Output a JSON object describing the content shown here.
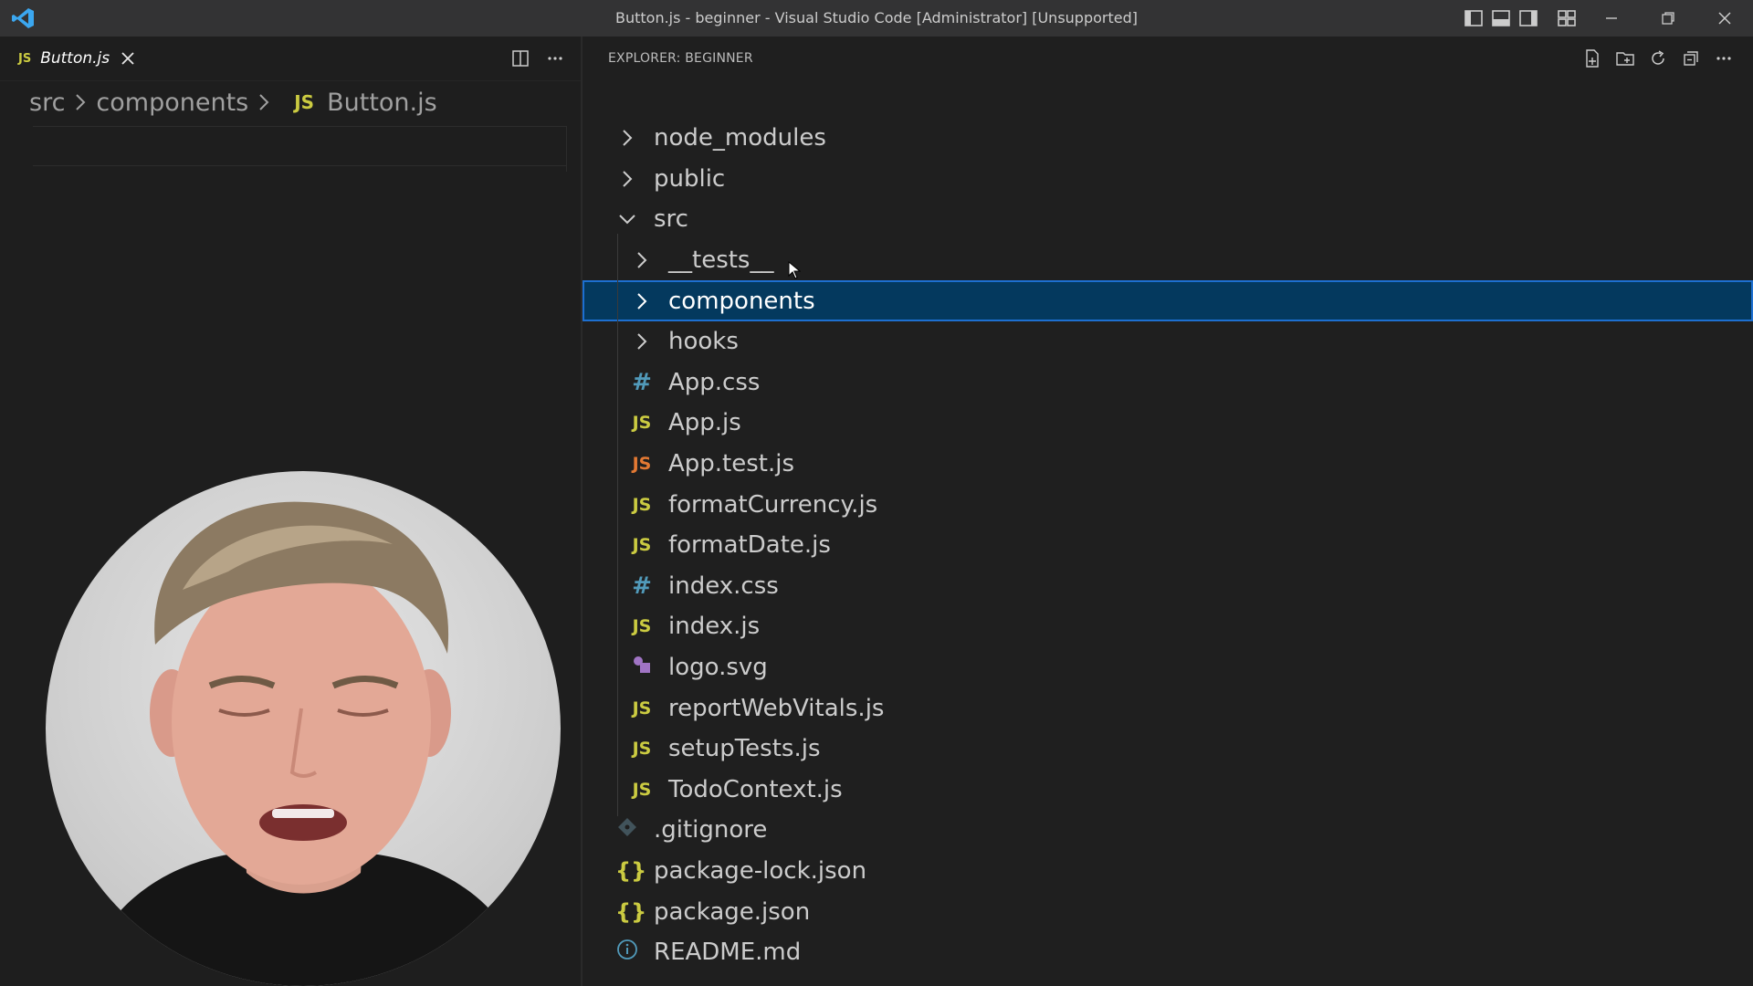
{
  "window": {
    "title": "Button.js - beginner - Visual Studio Code [Administrator] [Unsupported]"
  },
  "colors": {
    "titlebar_bg": "#333334",
    "editor_bg": "#1e1e1e",
    "selection_bg": "#04395e",
    "selection_border": "#1d6fd0",
    "js_icon": "#cbcb41",
    "test_icon": "#e37933",
    "css_icon": "#519aba"
  },
  "editor": {
    "tab": {
      "badge": "JS",
      "label": "Button.js",
      "icon": "close-icon"
    },
    "breadcrumb": {
      "parts": [
        "src",
        "components"
      ],
      "file_badge": "JS",
      "file": "Button.js"
    }
  },
  "explorer": {
    "header": "EXPLORER: BEGINNER",
    "actions": [
      "new-file-icon",
      "new-folder-icon",
      "refresh-icon",
      "collapse-all-icon",
      "more-icon"
    ],
    "items": [
      {
        "label": "node_modules",
        "type": "folder",
        "expanded": false,
        "depth": 0
      },
      {
        "label": "public",
        "type": "folder",
        "expanded": false,
        "depth": 0
      },
      {
        "label": "src",
        "type": "folder",
        "expanded": true,
        "depth": 0
      },
      {
        "label": "__tests__",
        "type": "folder",
        "expanded": false,
        "depth": 1
      },
      {
        "label": "components",
        "type": "folder",
        "expanded": false,
        "depth": 1,
        "selected": true
      },
      {
        "label": "hooks",
        "type": "folder",
        "expanded": false,
        "depth": 1
      },
      {
        "label": "App.css",
        "type": "css",
        "icon": "#",
        "depth": 1
      },
      {
        "label": "App.js",
        "type": "js",
        "icon": "JS",
        "depth": 1
      },
      {
        "label": "App.test.js",
        "type": "jstest",
        "icon": "JS",
        "depth": 1
      },
      {
        "label": "formatCurrency.js",
        "type": "js",
        "icon": "JS",
        "depth": 1
      },
      {
        "label": "formatDate.js",
        "type": "js",
        "icon": "JS",
        "depth": 1
      },
      {
        "label": "index.css",
        "type": "css",
        "icon": "#",
        "depth": 1
      },
      {
        "label": "index.js",
        "type": "js",
        "icon": "JS",
        "depth": 1
      },
      {
        "label": "logo.svg",
        "type": "svg",
        "depth": 1
      },
      {
        "label": "reportWebVitals.js",
        "type": "js",
        "icon": "JS",
        "depth": 1
      },
      {
        "label": "setupTests.js",
        "type": "js",
        "icon": "JS",
        "depth": 1
      },
      {
        "label": "TodoContext.js",
        "type": "js",
        "icon": "JS",
        "depth": 1
      },
      {
        "label": ".gitignore",
        "type": "git",
        "depth": 0
      },
      {
        "label": "package-lock.json",
        "type": "json",
        "icon": "{}",
        "depth": 0
      },
      {
        "label": "package.json",
        "type": "json",
        "icon": "{}",
        "depth": 0
      },
      {
        "label": "README.md",
        "type": "info",
        "depth": 0
      }
    ]
  }
}
